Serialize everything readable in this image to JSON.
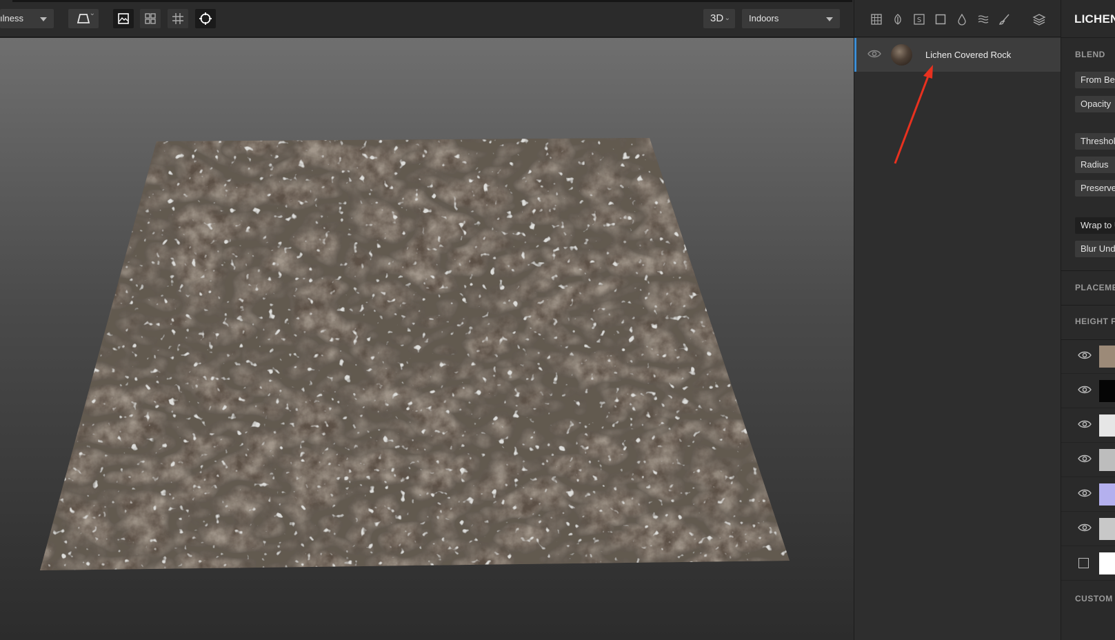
{
  "toolbar": {
    "channel_dropdown": "ılness",
    "view_mode": "3D",
    "environment": "Indoors",
    "icons": [
      "perspective-icon",
      "image-icon",
      "grid-tiles-icon",
      "grid-lines-icon",
      "target-icon"
    ]
  },
  "layers_panel": {
    "header_icons": [
      "table-icon",
      "leaf-icon",
      "s-box-icon",
      "square-icon",
      "drop-icon",
      "waves-icon",
      "brush-icon",
      "layers-icon"
    ],
    "layers": [
      {
        "name": "Lichen Covered Rock",
        "visible": true,
        "selected": true
      }
    ]
  },
  "properties_panel": {
    "title": "LICHEN C",
    "blend_section": {
      "label": "BLEND",
      "blend_mode": "From Be",
      "controls": [
        "Opacity",
        "Threshol",
        "Radius",
        "Preserve",
        "Wrap to U",
        "Blur Und"
      ]
    },
    "placement_label": "PLACEME",
    "height_label": "HEIGHT FI",
    "height_rows": [
      {
        "visible": true,
        "swatch": "#9c8a78"
      },
      {
        "visible": true,
        "swatch": "#050505"
      },
      {
        "visible": true,
        "swatch": "#e6e6e6"
      },
      {
        "visible": true,
        "swatch": "#bdbdbd"
      },
      {
        "visible": true,
        "swatch": "#b4b0ee"
      },
      {
        "visible": true,
        "swatch": "#c8c8c8"
      },
      {
        "visible": false,
        "swatch": "#ffffff"
      }
    ],
    "custom_label": "CUSTOM I"
  },
  "colors": {
    "selection_accent": "#3d8fd6",
    "annotation_arrow": "#e8311f"
  }
}
